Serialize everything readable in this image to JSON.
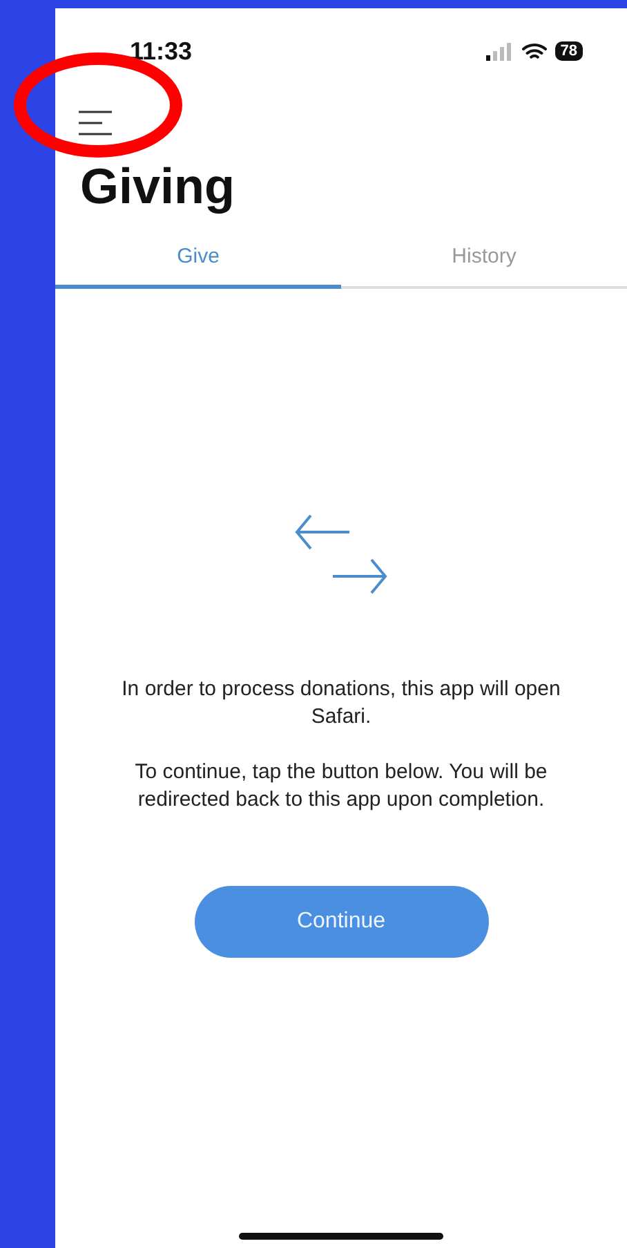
{
  "status_bar": {
    "time": "11:33",
    "battery": "78"
  },
  "title": "Giving",
  "tabs": [
    {
      "label": "Give",
      "selected": true
    },
    {
      "label": "History",
      "selected": false
    }
  ],
  "message": [
    "In order to process donations, this app will open Safari.",
    "To continue, tap the button below. You will be redirected back to this app upon completion."
  ],
  "button": "Continue"
}
